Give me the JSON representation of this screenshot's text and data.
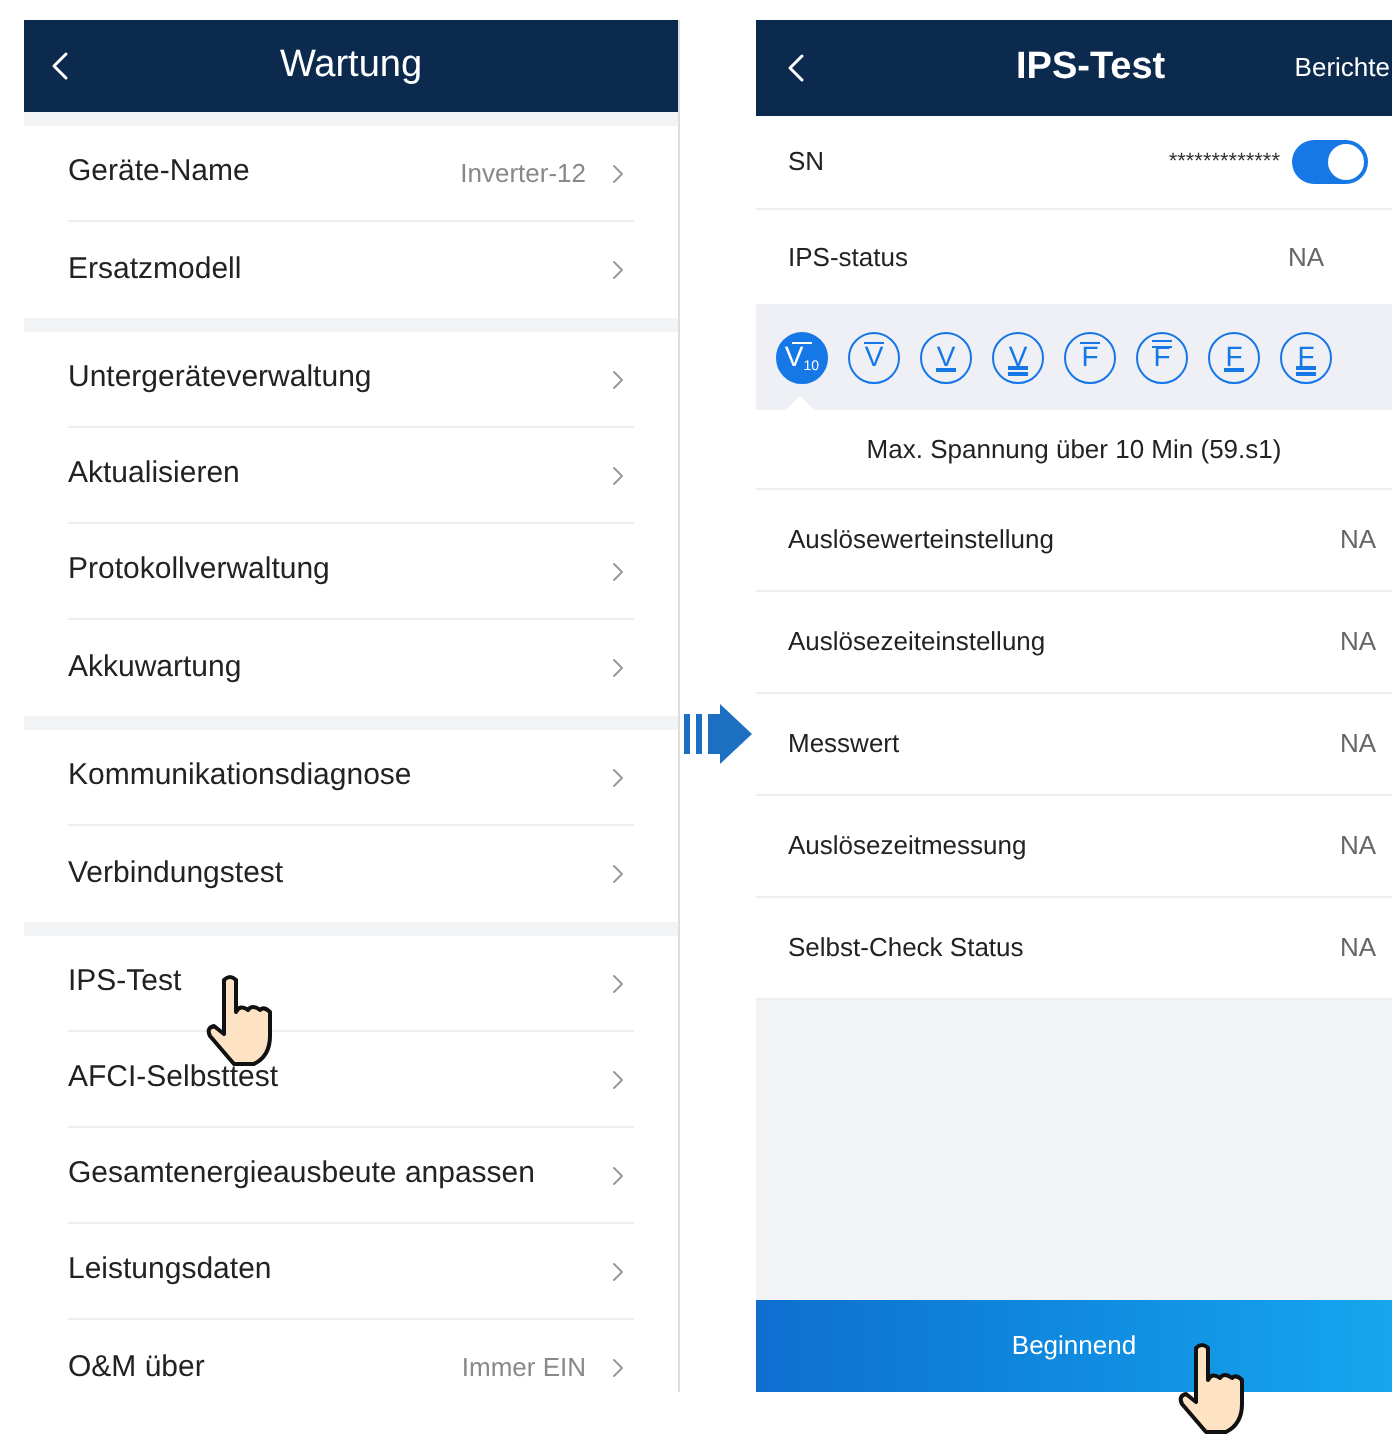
{
  "left_screen": {
    "title": "Wartung",
    "groups": [
      {
        "items": [
          {
            "label": "Geräte-Name",
            "value": "Inverter-12"
          },
          {
            "label": "Ersatzmodell"
          }
        ]
      },
      {
        "items": [
          {
            "label": "Untergeräteverwaltung"
          },
          {
            "label": "Aktualisieren"
          },
          {
            "label": "Protokollverwaltung"
          },
          {
            "label": "Akkuwartung"
          }
        ]
      },
      {
        "items": [
          {
            "label": "Kommunikationsdiagnose"
          },
          {
            "label": "Verbindungstest"
          }
        ]
      },
      {
        "items": [
          {
            "label": "IPS-Test"
          },
          {
            "label": "AFCI-Selbsttest"
          },
          {
            "label": "Gesamtenergieausbeute anpassen"
          },
          {
            "label": "Leistungsdaten"
          },
          {
            "label": "O&M über",
            "value": "Immer EIN"
          }
        ]
      }
    ]
  },
  "right_screen": {
    "title": "IPS-Test",
    "action": "Berichte",
    "sn": {
      "label": "SN",
      "value": "*************",
      "on": true
    },
    "status": {
      "label": "IPS-status",
      "value": "NA"
    },
    "tests": [
      {
        "letter": "V",
        "sub": "10",
        "kind": "over",
        "selected": true
      },
      {
        "letter": "V",
        "kind": "over",
        "selected": false
      },
      {
        "letter": "V",
        "kind": "under",
        "selected": false
      },
      {
        "letter": "V",
        "kind": "under2",
        "selected": false
      },
      {
        "letter": "F",
        "kind": "over",
        "selected": false
      },
      {
        "letter": "F",
        "kind": "over2",
        "selected": false
      },
      {
        "letter": "F",
        "kind": "under",
        "selected": false
      },
      {
        "letter": "F",
        "kind": "under2",
        "selected": false
      }
    ],
    "description": "Max. Spannung über 10 Min (59.s1)",
    "rows": [
      {
        "label": "Auslösewerteinstellung",
        "value": "NA"
      },
      {
        "label": "Auslösezeiteinstellung",
        "value": "NA"
      },
      {
        "label": "Messwert",
        "value": "NA"
      },
      {
        "label": "Auslösezeitmessung",
        "value": "NA"
      },
      {
        "label": "Selbst-Check Status",
        "value": "NA"
      }
    ],
    "start_button": "Beginnend"
  }
}
